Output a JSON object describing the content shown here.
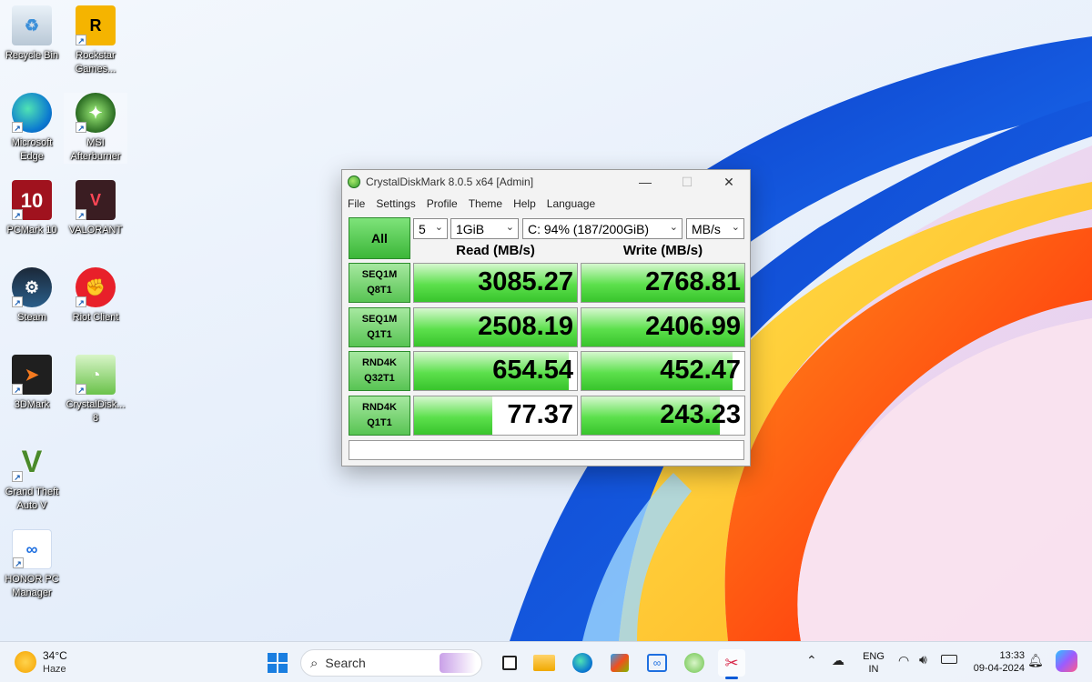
{
  "desktop": {
    "icons": [
      {
        "label": "Recycle Bin"
      },
      {
        "label": "Rockstar Games..."
      },
      {
        "label": "Microsoft Edge"
      },
      {
        "label": "MSI Afterburner"
      },
      {
        "label": "PCMark 10"
      },
      {
        "label": "VALORANT"
      },
      {
        "label": "Steam"
      },
      {
        "label": "Riot Client"
      },
      {
        "label": "3DMark"
      },
      {
        "label": "CrystalDisk... 8"
      },
      {
        "label": "Grand Theft Auto V"
      },
      {
        "label": "HONOR PC Manager"
      }
    ]
  },
  "window": {
    "title": "CrystalDiskMark 8.0.5 x64 [Admin]",
    "menu": [
      "File",
      "Settings",
      "Profile",
      "Theme",
      "Help",
      "Language"
    ],
    "all_button": "All",
    "count": "5",
    "size": "1GiB",
    "drive": "C: 94% (187/200GiB)",
    "unit": "MB/s",
    "read_header": "Read (MB/s)",
    "write_header": "Write (MB/s)",
    "rows": [
      {
        "line1": "SEQ1M",
        "line2": "Q8T1",
        "read": "3085.27",
        "write": "2768.81",
        "read_fill": 1.0,
        "write_fill": 1.0
      },
      {
        "line1": "SEQ1M",
        "line2": "Q1T1",
        "read": "2508.19",
        "write": "2406.99",
        "read_fill": 1.0,
        "write_fill": 1.0
      },
      {
        "line1": "RND4K",
        "line2": "Q32T1",
        "read": "654.54",
        "write": "452.47",
        "read_fill": 0.95,
        "write_fill": 0.93
      },
      {
        "line1": "RND4K",
        "line2": "Q1T1",
        "read": "77.37",
        "write": "243.23",
        "read_fill": 0.48,
        "write_fill": 0.85
      }
    ]
  },
  "taskbar": {
    "weather_temp": "34°C",
    "weather_desc": "Haze",
    "search_placeholder": "Search",
    "lang_line1": "ENG",
    "lang_line2": "IN",
    "time": "13:33",
    "date": "09-04-2024"
  },
  "colors": {
    "bar_green": "#38c42c",
    "accent_blue": "#0a5bd8"
  }
}
